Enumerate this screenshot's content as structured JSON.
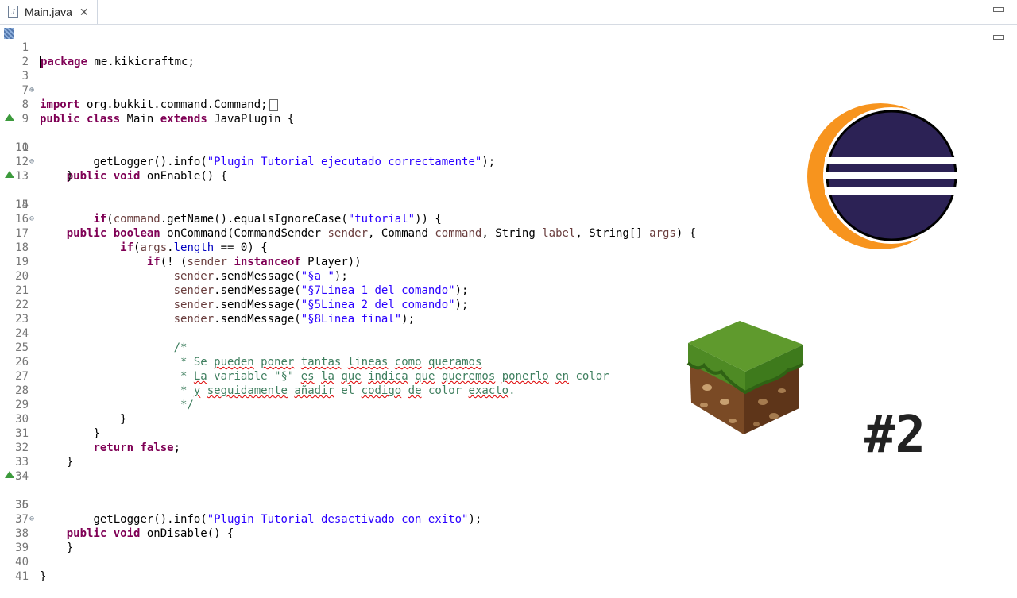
{
  "tab": {
    "title": "Main.java",
    "file_icon": "java-file-icon",
    "close_icon": "close-icon"
  },
  "code_lines": [
    {
      "n": "1"
    },
    {
      "n": "2"
    },
    {
      "n": "3"
    },
    {
      "n": "7"
    },
    {
      "n": "8"
    },
    {
      "n": "9"
    },
    {
      "n": "10"
    },
    {
      "n": "11"
    },
    {
      "n": "12"
    },
    {
      "n": "13"
    },
    {
      "n": "14"
    },
    {
      "n": "15"
    },
    {
      "n": "16"
    },
    {
      "n": "17"
    },
    {
      "n": "18"
    },
    {
      "n": "19"
    },
    {
      "n": "20"
    },
    {
      "n": "21"
    },
    {
      "n": "22"
    },
    {
      "n": "23"
    },
    {
      "n": "24"
    },
    {
      "n": "25"
    },
    {
      "n": "26"
    },
    {
      "n": "27"
    },
    {
      "n": "28"
    },
    {
      "n": "29"
    },
    {
      "n": "30"
    },
    {
      "n": "31"
    },
    {
      "n": "32"
    },
    {
      "n": "33"
    },
    {
      "n": "34"
    },
    {
      "n": "35"
    },
    {
      "n": "36"
    },
    {
      "n": "37"
    },
    {
      "n": "38"
    },
    {
      "n": "39"
    },
    {
      "n": "40"
    },
    {
      "n": "41"
    }
  ],
  "code": {
    "package_kw": "package",
    "package_name": " me.kikicraftmc;",
    "import_kw": "import",
    "import_name": " org.bukkit.command.Command;",
    "l8_public": "public",
    "l8_class": "class",
    "l8_main": " Main ",
    "l8_extends": "extends",
    "l8_rest": " JavaPlugin {",
    "l10_public": "public",
    "l10_void": "void",
    "l10_rest": " onEnable() {",
    "l11_pre": "getLogger().info(",
    "l11_str": "\"Plugin Tutorial ejecutado correctamente\"",
    "l11_post": ");",
    "brace_close": "}",
    "l14_public": "public",
    "l14_boolean": "boolean",
    "l14_a": " onCommand(CommandSender ",
    "l14_sender": "sender",
    "l14_b": ", Command ",
    "l14_command": "command",
    "l14_c": ", String ",
    "l14_label": "label",
    "l14_d": ", String[] ",
    "l14_args": "args",
    "l14_e": ") {",
    "l15_if": "if",
    "l15_a": "(",
    "l15_command": "command",
    "l15_b": ".getName().equalsIgnoreCase(",
    "l15_str": "\"tutorial\"",
    "l15_c": ")) {",
    "l17_if": "if",
    "l17_a": "(",
    "l17_args": "args",
    "l17_b": ".",
    "l17_length": "length",
    "l17_c": " == 0) {",
    "l18_if": "if",
    "l18_a": "(! (",
    "l18_sender": "sender",
    "l18_instanceof": "instanceof",
    "l18_b": " Player))",
    "sender": "sender",
    "send_pre": ".sendMessage(",
    "l19_str": "\"§a \"",
    "l20_str": "\"§7Linea 1 del comando\"",
    "l21_str": "\"§5Linea 2 del comando\"",
    "l22_str": "\"§8Linea final\"",
    "send_post": ");",
    "c24": "/*",
    "c25_a": " * Se ",
    "c25_b": "pueden",
    "c25_c": " ",
    "c25_d": "poner",
    "c25_e": " ",
    "c25_f": "tantas",
    "c25_g": " ",
    "c25_h": "lineas",
    "c25_i": " ",
    "c25_j": "como",
    "c25_k": " ",
    "c25_l": "queramos",
    "c26_a": " * ",
    "c26_b": "La",
    "c26_c": " variable \"§\" ",
    "c26_d": "es",
    "c26_e": " ",
    "c26_f": "la",
    "c26_g": " ",
    "c26_h": "que",
    "c26_i": " ",
    "c26_j": "indica",
    "c26_k": " ",
    "c26_l": "que",
    "c26_m": " ",
    "c26_n": "queremos",
    "c26_o": " ",
    "c26_p": "ponerlo",
    "c26_q": " ",
    "c26_r": "en",
    "c26_s": " color",
    "c27_a": " * ",
    "c27_b": "y",
    "c27_c": " ",
    "c27_d": "seguidamente",
    "c27_e": " ",
    "c27_f": "añadir",
    "c27_g": " el ",
    "c27_h": "codigo",
    "c27_i": " ",
    "c27_j": "de",
    "c27_k": " color ",
    "c27_l": "exacto",
    "c27_m": ".",
    "c28": " */",
    "return_kw": "return",
    "false_kw": "false",
    "semicolon": ";",
    "l35_public": "public",
    "l35_void": "void",
    "l35_rest": " onDisable() {",
    "l36_pre": "getLogger().info(",
    "l36_str": "\"Plugin Tutorial desactivado con exito\"",
    "l36_post": ");"
  },
  "overlay": {
    "eclipse_logo": "eclipse-logo",
    "grass_block": "minecraft-grass-block",
    "episode_number": "#2"
  },
  "colors": {
    "keyword": "#7f0055",
    "string": "#2a00ff",
    "field": "#0000c0",
    "variable": "#6a3e3e",
    "comment": "#3f7f5f",
    "eclipse_orange": "#f7941e",
    "eclipse_purple": "#2c2255"
  }
}
